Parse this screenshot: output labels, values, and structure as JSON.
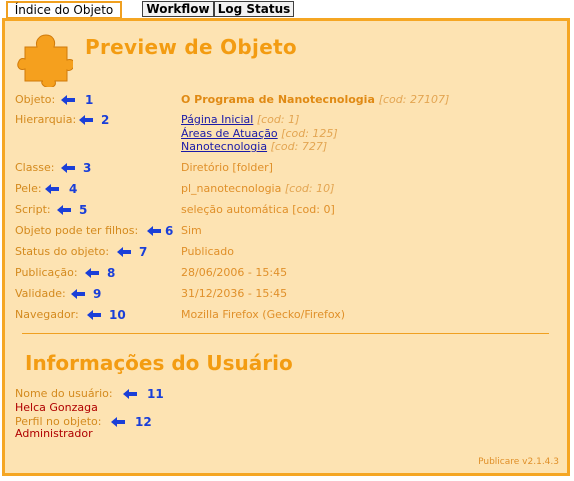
{
  "tabs": [
    {
      "label": "Índice do Objeto"
    },
    {
      "label": "Workflow"
    },
    {
      "label": "Log Status"
    }
  ],
  "header": {
    "title": "Preview de Objeto"
  },
  "fields": {
    "objeto": {
      "label": "Objeto:",
      "num": "1",
      "value": "O Programa de Nanotecnologia",
      "cod": "[cod: 27107]"
    },
    "hierarquia": {
      "label": "Hierarquia:",
      "num": "2",
      "items": [
        {
          "link": "Página Inicial",
          "cod": "[cod: 1]"
        },
        {
          "link": "Áreas de Atuação",
          "cod": "[cod: 125]"
        },
        {
          "link": "Nanotecnologia",
          "cod": "[cod: 727]"
        }
      ]
    },
    "classe": {
      "label": "Classe:",
      "num": "3",
      "value": "Diretório [folder]"
    },
    "pele": {
      "label": "Pele:",
      "num": "4",
      "value": "pl_nanotecnologia",
      "cod": "[cod: 10]"
    },
    "script": {
      "label": "Script:",
      "num": "5",
      "value": "seleção automática [cod: 0]"
    },
    "filhos": {
      "label": "Objeto pode ter filhos:",
      "num": "6",
      "value": "Sim"
    },
    "status": {
      "label": "Status do objeto:",
      "num": "7",
      "value": "Publicado"
    },
    "publicacao": {
      "label": "Publicação:",
      "num": "8",
      "value": "28/06/2006 - 15:45"
    },
    "validade": {
      "label": "Validade:",
      "num": "9",
      "value": "31/12/2036 - 15:45"
    },
    "navegador": {
      "label": "Navegador:",
      "num": "10",
      "value": "Mozilla Firefox (Gecko/Firefox)"
    }
  },
  "user_section": {
    "title": "Informações do Usuário",
    "nome": {
      "label": "Nome do usuário:",
      "num": "11",
      "value": "Helca Gonzaga"
    },
    "perfil": {
      "label": "Perfil no objeto:",
      "num": "12",
      "value": "Administrador"
    }
  },
  "footer": {
    "version": "Publicare v2.1.4.3"
  },
  "colors": {
    "accent": "#f39c12",
    "panel_bg": "#fde3b2",
    "annotation": "#1a3fd8"
  }
}
